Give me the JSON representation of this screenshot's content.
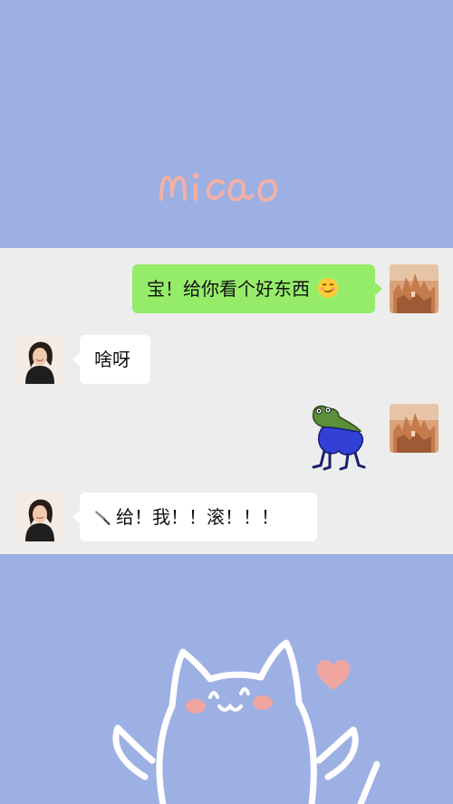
{
  "watermark": {
    "text": "miao"
  },
  "messages": [
    {
      "side": "right",
      "type": "text",
      "text": "宝！给你看个好东西",
      "emoji": "smirk-emoji"
    },
    {
      "side": "left",
      "type": "text",
      "text": "啥呀"
    },
    {
      "side": "right",
      "type": "sticker",
      "sticker": "frog-sticker"
    },
    {
      "side": "left",
      "type": "text",
      "text": "给！我！！滚！！！",
      "emoji": "knife-icon"
    }
  ],
  "colors": {
    "background": "#9cb0e3",
    "chat_background": "#ededed",
    "sent_bubble": "#95ec69",
    "received_bubble": "#ffffff",
    "doodle_pink": "#f0a5a0"
  },
  "decorations": [
    "cat-doodle",
    "heart-doodle"
  ]
}
